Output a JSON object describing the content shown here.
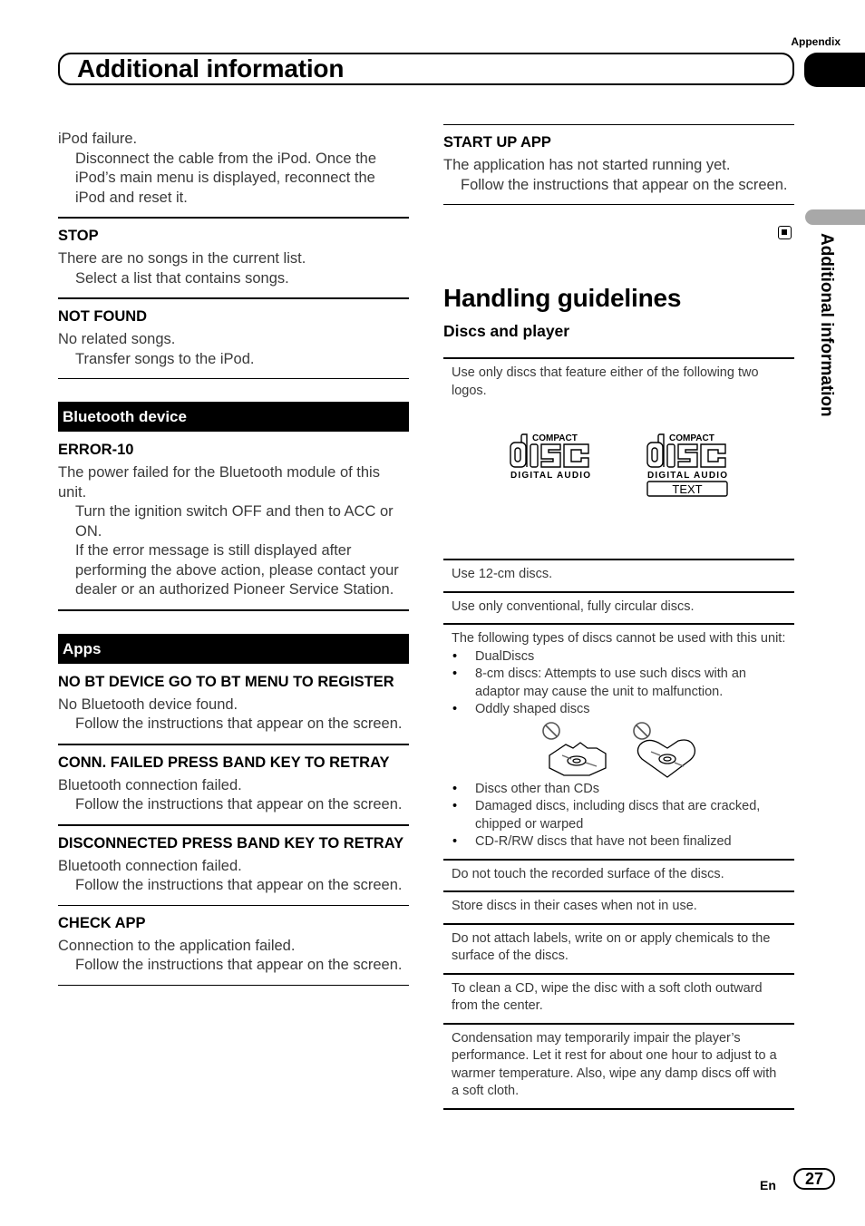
{
  "header": {
    "appendix": "Appendix",
    "title": "Additional information",
    "side_tab": "Additional information"
  },
  "left": {
    "intro": {
      "desc": "iPod failure.",
      "action": "Disconnect the cable from the iPod. Once the iPod’s main menu is displayed, reconnect the iPod and reset it."
    },
    "stop": {
      "code": "STOP",
      "desc": "There are no songs in the current list.",
      "action": "Select a list that contains songs."
    },
    "not_found": {
      "code": "NOT FOUND",
      "desc": "No related songs.",
      "action": "Transfer songs to the iPod."
    },
    "bluetooth": {
      "heading": "Bluetooth device",
      "error10": {
        "code": "ERROR-10",
        "desc": "The power failed for the Bluetooth module of this unit.",
        "action1": "Turn the ignition switch OFF and then to ACC or ON.",
        "action2": "If the error message is still displayed after performing the above action, please contact your dealer or an authorized Pioneer Service Station."
      }
    },
    "apps": {
      "heading": "Apps",
      "items": [
        {
          "code": "NO BT DEVICE GO TO BT MENU TO REGISTER",
          "desc": "No Bluetooth device found.",
          "action": "Follow the instructions that appear on the screen."
        },
        {
          "code": "CONN. FAILED PRESS BAND KEY TO RETRAY",
          "desc": "Bluetooth connection failed.",
          "action": "Follow the instructions that appear on the screen."
        },
        {
          "code": "DISCONNECTED PRESS BAND KEY TO RETRAY",
          "desc": "Bluetooth connection failed.",
          "action": "Follow the instructions that appear on the screen."
        },
        {
          "code": "CHECK APP",
          "desc": "Connection to the application failed.",
          "action": "Follow the instructions that appear on the screen."
        }
      ]
    }
  },
  "right": {
    "start_up": {
      "code": "START UP APP",
      "desc": "The application has not started running yet.",
      "action": "Follow the instructions that appear on the screen."
    },
    "handling": {
      "title": "Handling guidelines",
      "subtitle": "Discs and player",
      "logos_note": "Use only discs that feature either of the following two logos.",
      "logo_compact": "COMPACT",
      "logo_digital": "DIGITAL AUDIO",
      "logo_text": "TEXT",
      "rule_12cm": "Use 12-cm discs.",
      "rule_circular": "Use only conventional, fully circular discs.",
      "cannot_intro": "The following types of discs cannot be used with this unit:",
      "cannot_list_a": [
        "DualDiscs",
        "8-cm discs: Attempts to use such discs with an adaptor may cause the unit to malfunction.",
        "Oddly shaped discs"
      ],
      "cannot_list_b": [
        "Discs other than CDs",
        "Damaged discs, including discs that are cracked, chipped or warped",
        "CD-R/RW discs that have not been finalized"
      ],
      "rules_after": [
        "Do not touch the recorded surface of the discs.",
        "Store discs in their cases when not in use.",
        "Do not attach labels, write on or apply chemicals to the surface of the discs.",
        "To clean a CD, wipe the disc with a soft cloth outward from the center.",
        "Condensation may temporarily impair the player’s performance. Let it rest for about one hour to adjust to a warmer temperature. Also, wipe any damp discs off with a soft cloth."
      ]
    }
  },
  "footer": {
    "lang": "En",
    "page": "27"
  }
}
